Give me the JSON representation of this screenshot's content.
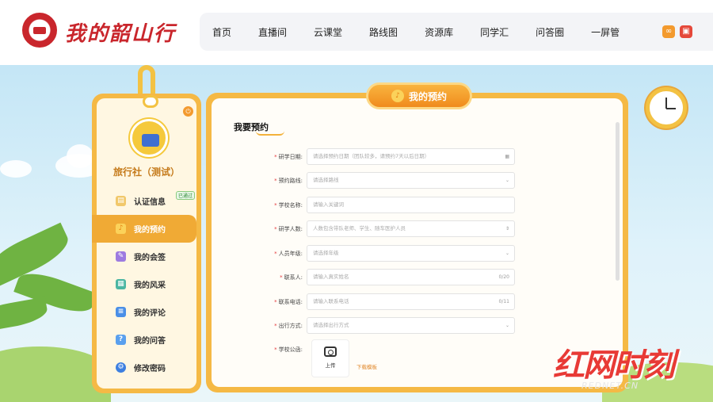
{
  "brand": {
    "logo_text": "我的韶山行"
  },
  "nav": {
    "items": [
      "首页",
      "直播间",
      "云课堂",
      "路线图",
      "资源库",
      "同学汇",
      "问答圈",
      "一屏管"
    ]
  },
  "sidebar": {
    "org_name": "旅行社（测试）",
    "items": [
      {
        "label": "认证信息",
        "badge": "已通过",
        "icon": "certificate-icon"
      },
      {
        "label": "我的预约",
        "icon": "bell-icon",
        "active": true
      },
      {
        "label": "我的会签",
        "icon": "pen-icon"
      },
      {
        "label": "我的风采",
        "icon": "picture-icon"
      },
      {
        "label": "我的评论",
        "icon": "comment-icon"
      },
      {
        "label": "我的问答",
        "icon": "qa-icon"
      },
      {
        "label": "修改密码",
        "icon": "gear-icon"
      }
    ]
  },
  "main": {
    "ribbon_title": "我的预约",
    "form_title": "我要预约",
    "fields": [
      {
        "label": "研学日期:",
        "required": true,
        "placeholder": "请选择预约日期（团队较多，请预约7天以后日期）",
        "suffix": "▦"
      },
      {
        "label": "预约路线:",
        "required": true,
        "placeholder": "请选择路线",
        "suffix": "⌄"
      },
      {
        "label": "学校名称:",
        "required": true,
        "placeholder": "请输入关键词",
        "suffix": ""
      },
      {
        "label": "研学人数:",
        "required": true,
        "placeholder": "人数包含带队老师、学生、随车医护人员",
        "suffix": "⇕"
      },
      {
        "label": "人员年级:",
        "required": true,
        "placeholder": "请选择年级",
        "suffix": "⌄"
      },
      {
        "label": "联系人:",
        "required": true,
        "placeholder": "请输入真实姓名",
        "suffix": "0/20"
      },
      {
        "label": "联系电话:",
        "required": true,
        "placeholder": "请输入联系电话",
        "suffix": "0/11"
      },
      {
        "label": "出行方式:",
        "required": true,
        "placeholder": "请选择出行方式",
        "suffix": "⌄"
      }
    ],
    "upload_field_label": "学校公函:",
    "upload_label": "上传",
    "download_template": "下载模板"
  },
  "watermark": {
    "main": "红网时刻",
    "sub": "REDNET.CN"
  }
}
